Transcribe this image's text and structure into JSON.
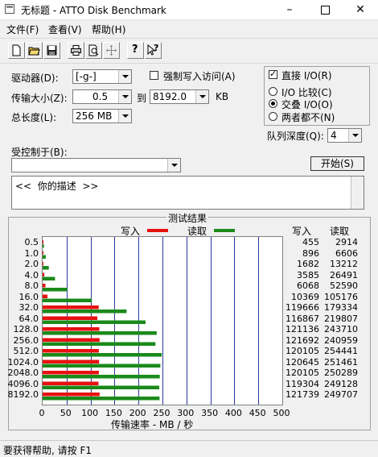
{
  "window": {
    "title": "无标题 - ATTO Disk Benchmark"
  },
  "menu": {
    "file": "文件(F)",
    "view": "查看(V)",
    "help": "帮助(H)"
  },
  "toolbar": {
    "help_glyph": "?",
    "whatsthis_glyph": "?"
  },
  "settings": {
    "drive_label": "驱动器(D):",
    "drive_value": "[-g-]",
    "transfer_label": "传输大小(Z):",
    "transfer_from": "0.5",
    "to_label": "到",
    "transfer_to": "8192.0",
    "unit": "KB",
    "length_label": "总长度(L):",
    "length_value": "256 MB",
    "force_write_label": "强制写入访问(A)",
    "direct_io_label": "直接 I/O(R)",
    "io_compare_label": "I/O 比较(C)",
    "overlapped_io_label": "交叠 I/O(O)",
    "neither_label": "两者都不(N)",
    "queue_label": "队列深度(Q):",
    "queue_value": "4",
    "controlled_by_label": "受控制于(B):",
    "controlled_by_value": "",
    "start_button": "开始(S)",
    "description": "<<  你的描述  >>"
  },
  "results": {
    "group_title": "测试结果",
    "legend_write": "写入",
    "legend_read": "读取",
    "col_write": "写入",
    "col_read": "读取",
    "x_axis_label": "传输速率 - MB / 秒",
    "colors": {
      "write": "#e81010",
      "read": "#1a8a1a"
    }
  },
  "chart_data": {
    "type": "bar",
    "orientation": "horizontal",
    "categories": [
      "0.5",
      "1.0",
      "2.0",
      "4.0",
      "8.0",
      "16.0",
      "32.0",
      "64.0",
      "128.0",
      "256.0",
      "512.0",
      "1024.0",
      "2048.0",
      "4096.0",
      "8192.0"
    ],
    "series": [
      {
        "name": "写入",
        "values": [
          0.4,
          0.9,
          1.6,
          3.5,
          5.9,
          10.1,
          117.0,
          114.1,
          118.3,
          118.8,
          117.3,
          117.8,
          117.3,
          116.5,
          118.9
        ]
      },
      {
        "name": "读取",
        "values": [
          2.8,
          6.5,
          12.9,
          25.8,
          51.4,
          102.7,
          175.1,
          214.7,
          238.0,
          235.3,
          248.5,
          245.6,
          244.4,
          243.3,
          243.9
        ]
      }
    ],
    "write_kbps": [
      "455",
      "896",
      "1682",
      "3585",
      "6068",
      "10369",
      "119666",
      "116867",
      "121136",
      "121692",
      "120105",
      "120645",
      "120105",
      "119304",
      "121739"
    ],
    "read_kbps": [
      "2914",
      "6606",
      "13212",
      "26491",
      "52590",
      "105176",
      "179334",
      "219807",
      "243710",
      "240959",
      "254441",
      "251461",
      "250289",
      "249128",
      "249707"
    ],
    "xticks": [
      "0",
      "50",
      "100",
      "150",
      "200",
      "250",
      "300",
      "350",
      "400",
      "450",
      "500"
    ],
    "xlim": [
      0,
      500
    ],
    "xlabel": "传输速率 - MB / 秒",
    "grid": true
  },
  "status": {
    "text": "要获得帮助, 请按 F1"
  }
}
